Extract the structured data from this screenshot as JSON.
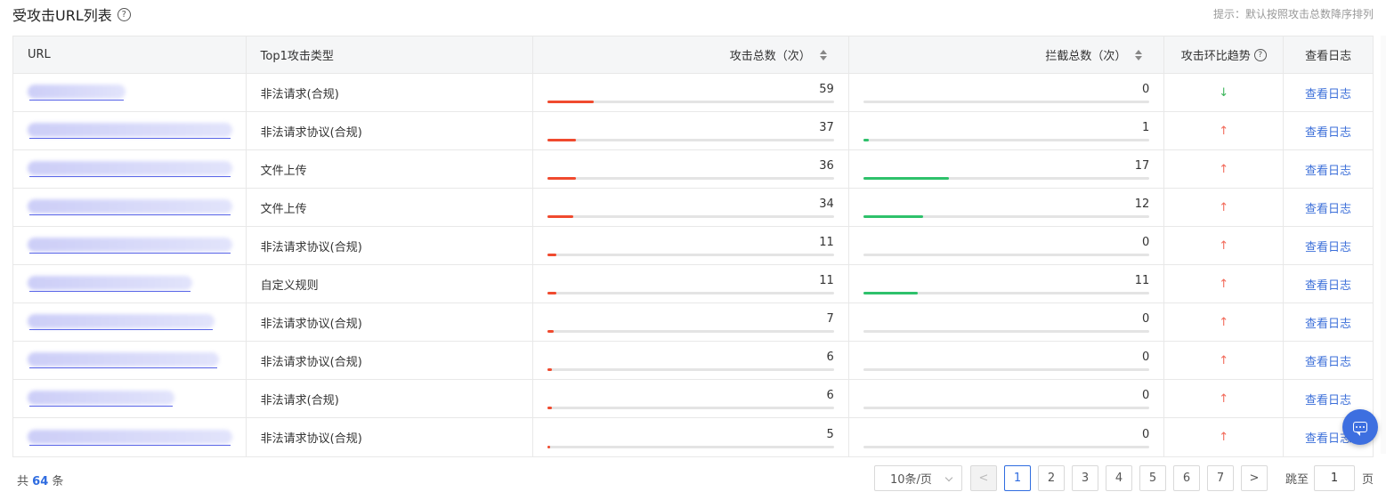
{
  "header": {
    "title": "受攻击URL列表",
    "help": "?",
    "hint": "提示：默认按照攻击总数降序排列"
  },
  "columns": {
    "url": "URL",
    "type": "Top1攻击类型",
    "attacks": "攻击总数（次）",
    "blocks": "拦截总数（次）",
    "trend": "攻击环比趋势",
    "log": "查看日志"
  },
  "rows": [
    {
      "type": "非法请求(合规)",
      "attacks": "59",
      "attack_frac": 0.16,
      "blocks": "0",
      "block_frac": 0,
      "trend": "↓",
      "trend_dir": "down",
      "log": "查看日志"
    },
    {
      "type": "非法请求协议(合规)",
      "attacks": "37",
      "attack_frac": 0.1,
      "blocks": "1",
      "block_frac": 0.02,
      "trend": "↑",
      "trend_dir": "up",
      "log": "查看日志"
    },
    {
      "type": "文件上传",
      "attacks": "36",
      "attack_frac": 0.1,
      "blocks": "17",
      "block_frac": 0.3,
      "trend": "↑",
      "trend_dir": "up",
      "log": "查看日志"
    },
    {
      "type": "文件上传",
      "attacks": "34",
      "attack_frac": 0.09,
      "blocks": "12",
      "block_frac": 0.21,
      "trend": "↑",
      "trend_dir": "up",
      "log": "查看日志"
    },
    {
      "type": "非法请求协议(合规)",
      "attacks": "11",
      "attack_frac": 0.03,
      "blocks": "0",
      "block_frac": 0,
      "trend": "↑",
      "trend_dir": "up",
      "log": "查看日志"
    },
    {
      "type": "自定义规则",
      "attacks": "11",
      "attack_frac": 0.03,
      "blocks": "11",
      "block_frac": 0.19,
      "trend": "↑",
      "trend_dir": "up",
      "log": "查看日志"
    },
    {
      "type": "非法请求协议(合规)",
      "attacks": "7",
      "attack_frac": 0.02,
      "blocks": "0",
      "block_frac": 0,
      "trend": "↑",
      "trend_dir": "up",
      "log": "查看日志"
    },
    {
      "type": "非法请求协议(合规)",
      "attacks": "6",
      "attack_frac": 0.015,
      "blocks": "0",
      "block_frac": 0,
      "trend": "↑",
      "trend_dir": "up",
      "log": "查看日志"
    },
    {
      "type": "非法请求(合规)",
      "attacks": "6",
      "attack_frac": 0.015,
      "blocks": "0",
      "block_frac": 0,
      "trend": "↑",
      "trend_dir": "up",
      "log": "查看日志"
    },
    {
      "type": "非法请求协议(合规)",
      "attacks": "5",
      "attack_frac": 0.01,
      "blocks": "0",
      "block_frac": 0,
      "trend": "↑",
      "trend_dir": "up",
      "log": "查看日志"
    }
  ],
  "footer": {
    "total_prefix": "共",
    "total": "64",
    "total_suffix": "条",
    "page_size": "10条/页",
    "prev": "<",
    "pages": [
      "1",
      "2",
      "3",
      "4",
      "5",
      "6",
      "7"
    ],
    "next": ">",
    "jump_label": "跳至",
    "jump_value": "1",
    "jump_suffix": "页"
  },
  "colors": {
    "attack_bar": "#f04a2e",
    "block_bar": "#2ec16b",
    "link": "#3c6fd9",
    "trend_up": "#f26a5a",
    "trend_down": "#3cb55a"
  }
}
